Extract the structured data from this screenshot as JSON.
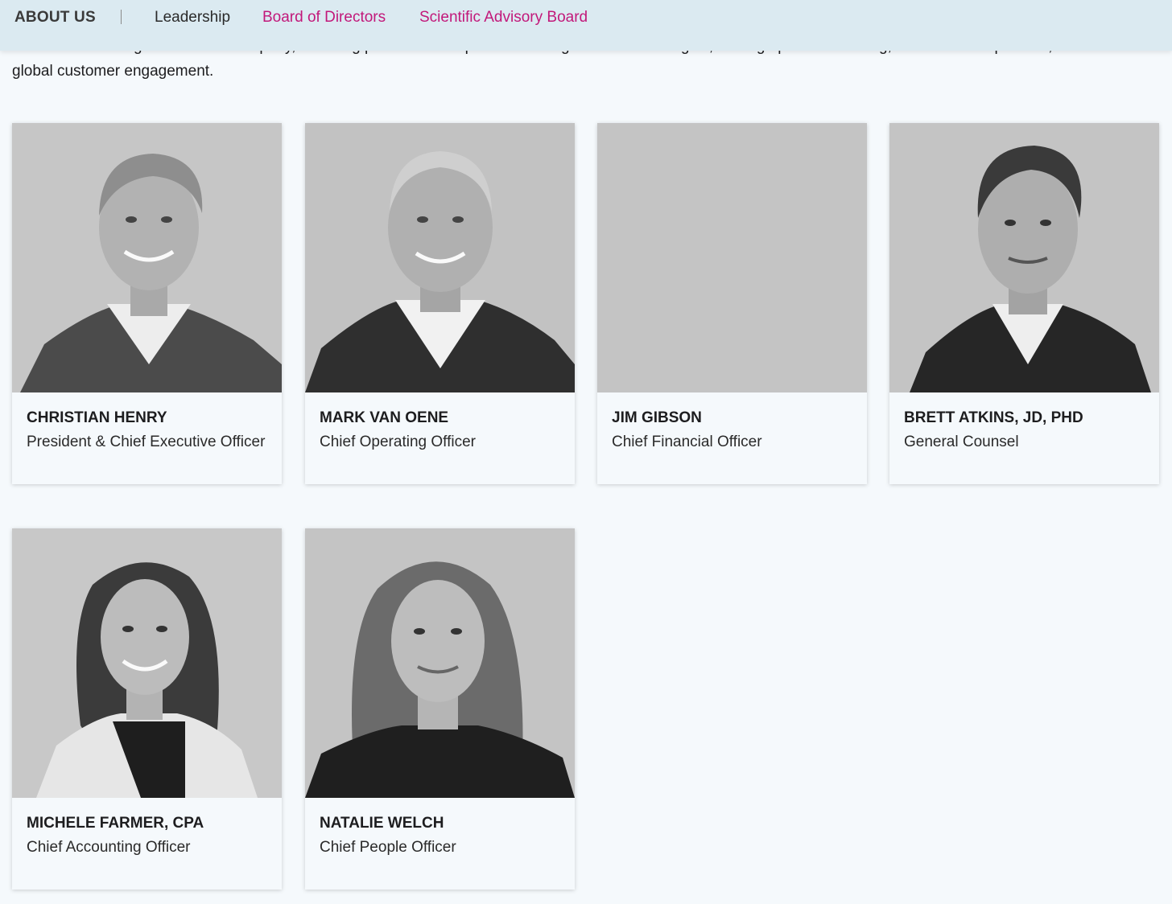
{
  "intro": {
    "text_partial": "wealth of knowledge to lead the company, including product development across genomic technologies, scaling up manufacturing, commercial expansion, and",
    "text_line2": "global customer engagement."
  },
  "subnav": {
    "section": "ABOUT US",
    "links": [
      {
        "label": "Leadership",
        "color": "#2a2a2a"
      },
      {
        "label": "Board of Directors",
        "color": "#c2187a"
      },
      {
        "label": "Scientific Advisory Board",
        "color": "#c2187a"
      }
    ]
  },
  "people": [
    {
      "name": "CHRISTIAN HENRY",
      "title": "President & Chief Executive Officer",
      "photo": "man-gray-hair"
    },
    {
      "name": "MARK VAN OENE",
      "title": "Chief Operating Officer",
      "photo": "man-short-hair"
    },
    {
      "name": "JIM GIBSON",
      "title": "Chief Financial Officer",
      "photo": "empty"
    },
    {
      "name": "BRETT ATKINS, JD, PHD",
      "title": "General Counsel",
      "photo": "man-dark-hair"
    },
    {
      "name": "MICHELE FARMER, CPA",
      "title": "Chief Accounting Officer",
      "photo": "woman-dark-hair"
    },
    {
      "name": "NATALIE WELCH",
      "title": "Chief People Officer",
      "photo": "woman-long-hair"
    }
  ]
}
